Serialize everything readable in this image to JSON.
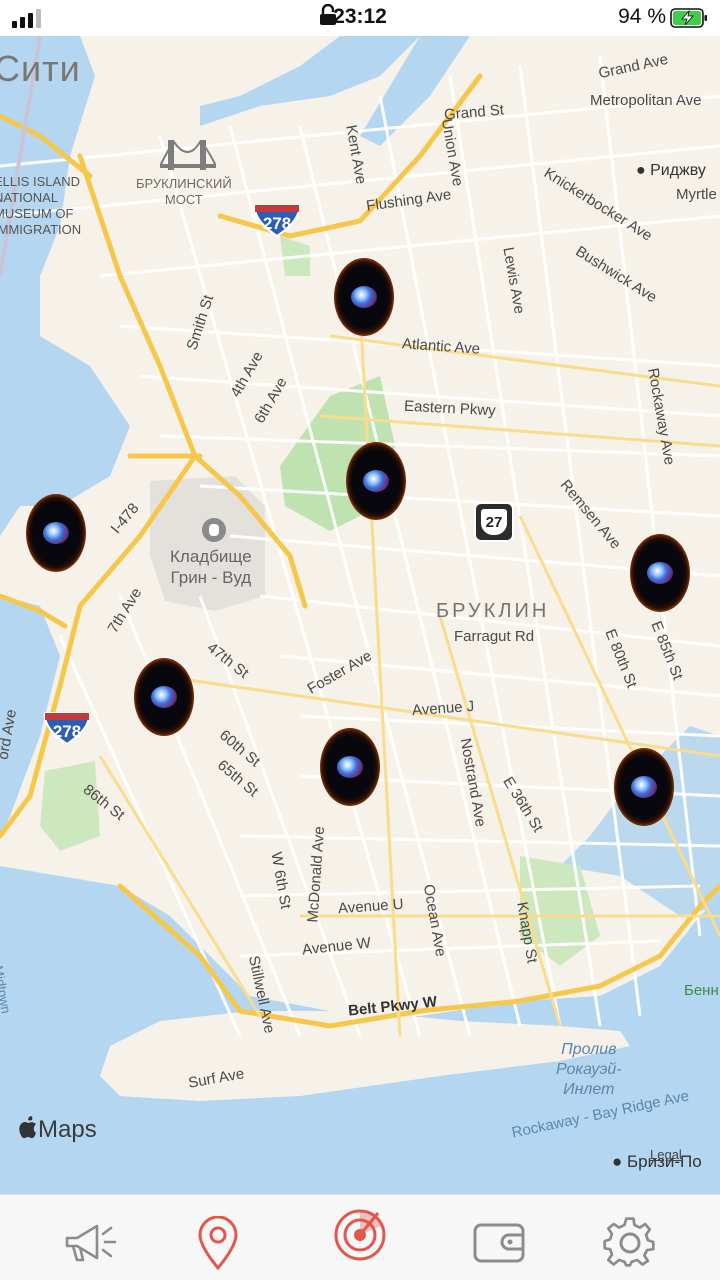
{
  "status_bar": {
    "time": "23:12",
    "battery_percent": "94 %",
    "icons": [
      "signal-icon",
      "lock-icon",
      "battery-charging-icon"
    ]
  },
  "map": {
    "city_label": "Сити",
    "district_label": "БРУКЛИН",
    "museum_label_lines": [
      "ELLIS ISLAND",
      "NATIONAL",
      "MUSEUM OF",
      "IMMIGRATION"
    ],
    "bridge_label_lines": [
      "БРУКЛИНСКИЙ",
      "МОСТ"
    ],
    "cemetery_label_lines": [
      "Кладбище",
      "Грин - Вуд"
    ],
    "ridgewood_label": "Риджву",
    "water_label_lines": [
      "Пролив",
      "Рокауэй-",
      "Инлет"
    ],
    "breezy_label": "Бризи-По",
    "bennett_label": "Бенн",
    "midtown_label": "Midtown",
    "streets": {
      "grand_ave": "Grand Ave",
      "grand_st": "Grand St",
      "metropolitan": "Metropolitan Ave",
      "myrtle": "Myrtle",
      "union_ave": "Union Ave",
      "kent_ave": "Kent Ave",
      "knickerbocker": "Knickerbocker Ave",
      "flushing": "Flushing Ave",
      "bushwick": "Bushwick Ave",
      "lewis": "Lewis Ave",
      "smith": "Smith St",
      "fourth_ave": "4th Ave",
      "sixth_ave": "6th Ave",
      "atlantic": "Atlantic Ave",
      "rockaway_ave": "Rockaway Ave",
      "eastern_pkwy": "Eastern Pkwy",
      "i478": "I-478",
      "remsen": "Remsen Ave",
      "seventh_ave": "7th Ave",
      "farragut": "Farragut Rd",
      "e80th": "E 80th St",
      "e85th": "E 85th St",
      "forty_seventh": "47th St",
      "foster": "Foster Ave",
      "avenue_j": "Avenue J",
      "ford_ave": "ord Ave",
      "sixtieth": "60th St",
      "sixty_fifth": "65th St",
      "nostrand": "Nostrand Ave",
      "e36th": "E 36th St",
      "eighty_sixth": "86th St",
      "mcdonald": "McDonald Ave",
      "w6th": "W 6th St",
      "avenue_u": "Avenue U",
      "avenue_w": "Avenue W",
      "ocean": "Ocean Ave",
      "knapp": "Knapp St",
      "stillwell": "Stillwell Ave",
      "belt": "Belt Pkwy W",
      "surf": "Surf Ave",
      "rockaway_bay": "Rockaway - Bay Ridge Ave"
    },
    "shields": {
      "i278_top": "278",
      "i278_bottom": "278",
      "route27": "27"
    },
    "markers": [
      "portal-marker",
      "portal-marker",
      "portal-marker",
      "portal-marker",
      "portal-marker",
      "portal-marker",
      "portal-marker"
    ]
  },
  "attribution": {
    "maps_text": "Maps",
    "legal_text": "Legal"
  },
  "tab_bar": {
    "items": [
      {
        "icon": "megaphone-icon"
      },
      {
        "icon": "map-pin-icon"
      },
      {
        "icon": "radar-target-icon",
        "active": true
      },
      {
        "icon": "wallet-icon"
      },
      {
        "icon": "gear-icon"
      }
    ],
    "accent_color": "#e2574c",
    "inactive_color": "#8c8c8c"
  },
  "colors": {
    "water": "#b4d6f0",
    "land": "#f6f2ea",
    "park": "#bfe3b0",
    "highway": "#f5c84c"
  }
}
